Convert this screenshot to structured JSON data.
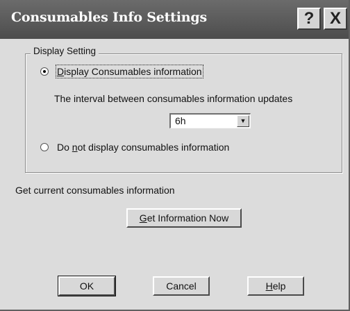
{
  "window": {
    "title": "Consumables Info Settings",
    "help_glyph": "?",
    "close_glyph": "X"
  },
  "display_setting": {
    "group_label": "Display Setting",
    "option_display": {
      "accel": "D",
      "rest": "isplay Consumables information",
      "checked": true
    },
    "interval_label": "The interval between consumables information updates",
    "interval_value": "6h",
    "option_hide": {
      "before": "Do ",
      "accel": "n",
      "rest": "ot display consumables information",
      "checked": false
    }
  },
  "current_info": {
    "label": "Get current consumables information",
    "button": {
      "accel": "G",
      "rest": "et Information Now"
    }
  },
  "footer": {
    "ok_label": "OK",
    "cancel_label": "Cancel",
    "help": {
      "accel": "H",
      "rest": "elp"
    }
  },
  "icons": {
    "radio_selected": "radio-selected-icon",
    "radio_unselected": "radio-unselected-icon",
    "dropdown_arrow": "chevron-down-icon"
  }
}
